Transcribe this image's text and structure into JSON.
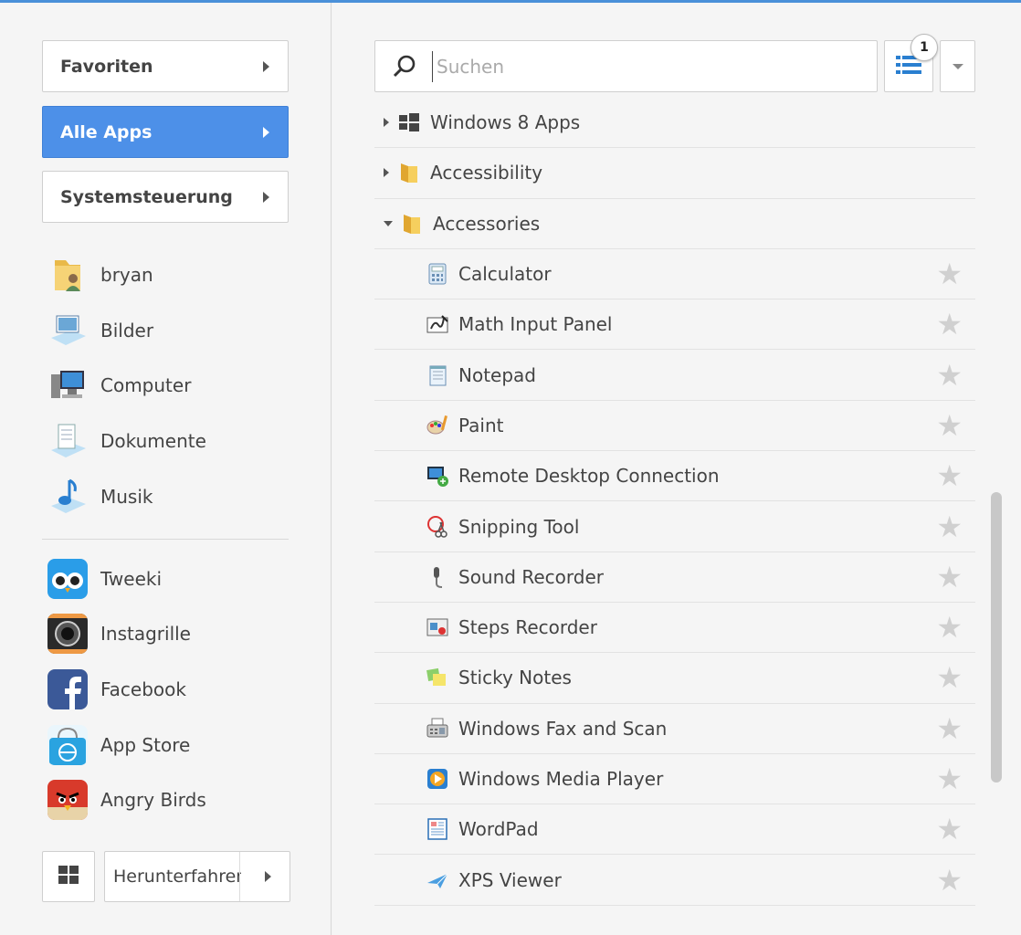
{
  "sidebar": {
    "nav": [
      {
        "label": "Favoriten"
      },
      {
        "label": "Alle Apps"
      },
      {
        "label": "Systemsteuerung"
      }
    ],
    "places": [
      {
        "label": "bryan",
        "icon": "user-folder-icon"
      },
      {
        "label": "Bilder",
        "icon": "pictures-icon"
      },
      {
        "label": "Computer",
        "icon": "computer-icon"
      },
      {
        "label": "Dokumente",
        "icon": "documents-icon"
      },
      {
        "label": "Musik",
        "icon": "music-icon"
      }
    ],
    "apps": [
      {
        "label": "Tweeki",
        "icon": "tweeki-icon"
      },
      {
        "label": "Instagrille",
        "icon": "instagrille-icon"
      },
      {
        "label": "Facebook",
        "icon": "facebook-icon"
      },
      {
        "label": "App Store",
        "icon": "app-store-icon"
      },
      {
        "label": "Angry Birds",
        "icon": "angry-birds-icon"
      }
    ],
    "shutdown_label": "Herunterfahren"
  },
  "main": {
    "search": {
      "placeholder": "Suchen"
    },
    "badge_count": "1",
    "folders": [
      {
        "label": "Windows 8 Apps",
        "expanded": false
      },
      {
        "label": "Accessibility",
        "expanded": false
      },
      {
        "label": "Accessories",
        "expanded": true
      }
    ],
    "items": [
      {
        "label": "Calculator",
        "icon": "calculator-icon"
      },
      {
        "label": "Math Input Panel",
        "icon": "math-input-icon"
      },
      {
        "label": "Notepad",
        "icon": "notepad-icon"
      },
      {
        "label": "Paint",
        "icon": "paint-icon"
      },
      {
        "label": "Remote Desktop Connection",
        "icon": "remote-desktop-icon"
      },
      {
        "label": "Snipping Tool",
        "icon": "snipping-tool-icon"
      },
      {
        "label": "Sound Recorder",
        "icon": "microphone-icon"
      },
      {
        "label": "Steps Recorder",
        "icon": "steps-recorder-icon"
      },
      {
        "label": "Sticky Notes",
        "icon": "sticky-notes-icon"
      },
      {
        "label": "Windows Fax and Scan",
        "icon": "fax-icon"
      },
      {
        "label": "Windows Media Player",
        "icon": "media-player-icon"
      },
      {
        "label": "WordPad",
        "icon": "wordpad-icon"
      },
      {
        "label": "XPS Viewer",
        "icon": "xps-viewer-icon"
      }
    ]
  },
  "colors": {
    "accent": "#4d90e8",
    "star": "#d0d0d0"
  }
}
